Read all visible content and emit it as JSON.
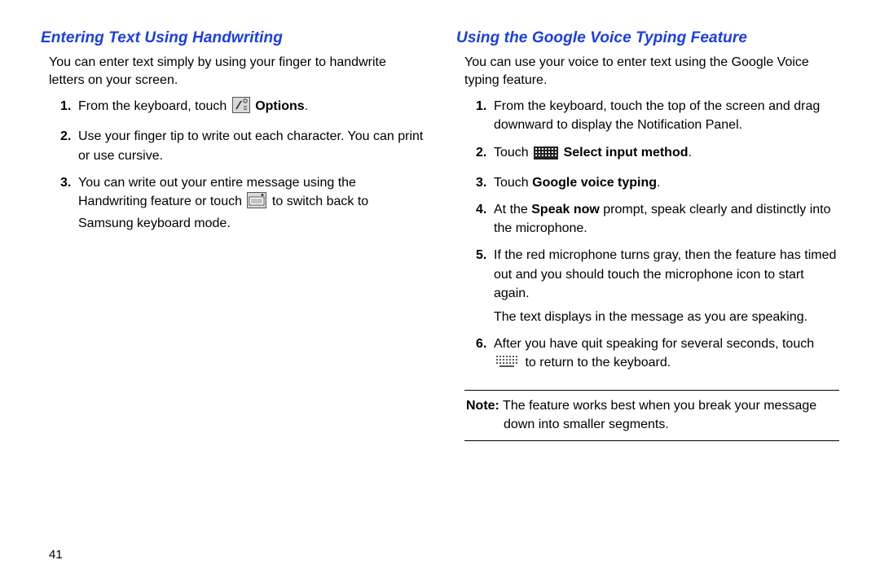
{
  "page_number": "41",
  "left": {
    "title": "Entering Text Using Handwriting",
    "intro": "You can enter text simply by using your finger to handwrite letters on your screen.",
    "steps": [
      {
        "num": "1.",
        "pre": "From the keyboard, touch ",
        "icon": "handwriting-options-icon",
        "post_bold": " Options",
        "tail": "."
      },
      {
        "num": "2.",
        "text": "Use your finger tip to write out each character. You can print or use cursive."
      },
      {
        "num": "3.",
        "pre": "You can write out your entire message using the Handwriting feature or touch ",
        "icon": "keyboard-mode-icon",
        "post": " to switch back to Samsung keyboard mode."
      }
    ]
  },
  "right": {
    "title": "Using the Google Voice Typing Feature",
    "intro": "You can use your voice to enter text using the Google Voice typing feature.",
    "steps": [
      {
        "num": "1.",
        "text": "From the keyboard, touch the top of the screen and drag downward to display the Notification Panel."
      },
      {
        "num": "2.",
        "pre": "Touch ",
        "icon": "input-method-grid-icon",
        "post_bold": " Select input method",
        "tail": "."
      },
      {
        "num": "3.",
        "pre": "Touch ",
        "bold": "Google voice typing",
        "tail": "."
      },
      {
        "num": "4.",
        "pre": "At the ",
        "bold": "Speak now",
        "post": " prompt, speak clearly and distinctly into the microphone."
      },
      {
        "num": "5.",
        "text": "If the red microphone turns gray, then the feature has timed out and you should touch the microphone icon to start again.",
        "extra": "The text displays in the message as you are speaking."
      },
      {
        "num": "6.",
        "pre": "After you have quit speaking for several seconds, touch ",
        "icon": "keyboard-return-icon",
        "post": " to return to the keyboard."
      }
    ],
    "note_label": "Note:",
    "note_first": " The feature works best when you break your message",
    "note_rest": "down into smaller segments."
  }
}
